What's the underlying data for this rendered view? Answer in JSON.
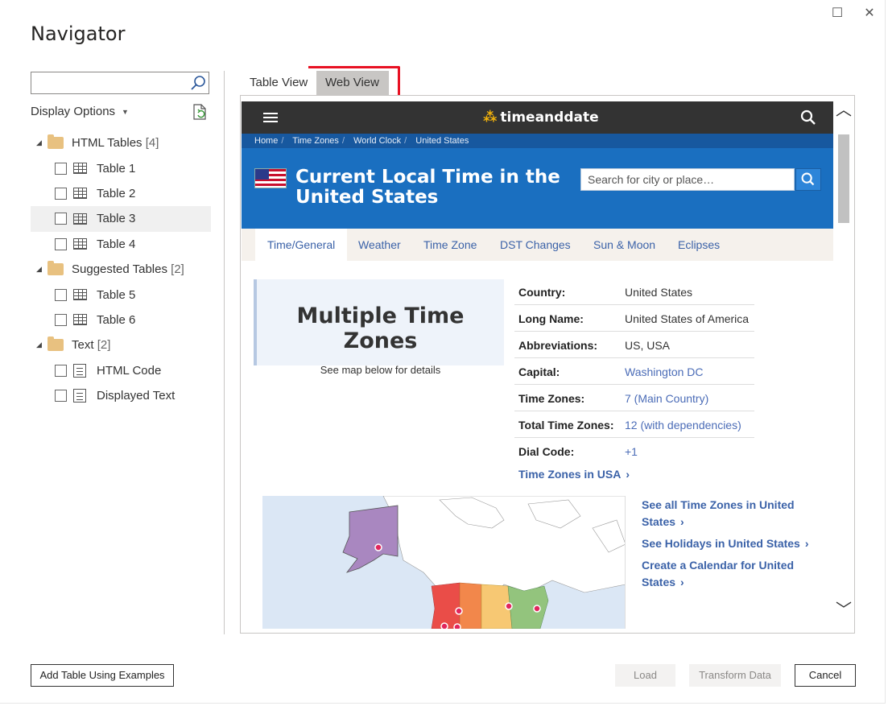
{
  "window": {
    "title": "Navigator",
    "maximize_glyph": "☐",
    "close_glyph": "✕"
  },
  "left_pane": {
    "search": {
      "placeholder": "",
      "value": ""
    },
    "display_options_label": "Display Options",
    "tree": {
      "groups": [
        {
          "label": "HTML Tables",
          "count": "[4]",
          "items": [
            "Table 1",
            "Table 2",
            "Table 3",
            "Table 4"
          ]
        },
        {
          "label": "Suggested Tables",
          "count": "[2]",
          "items": [
            "Table 5",
            "Table 6"
          ]
        },
        {
          "label": "Text",
          "count": "[2]",
          "items": [
            "HTML Code",
            "Displayed Text"
          ]
        }
      ],
      "selected_item": "Table 3"
    }
  },
  "right_pane": {
    "tabs": [
      "Table View",
      "Web View"
    ],
    "active_tab": "Web View",
    "web_page": {
      "logo": "timeanddate",
      "breadcrumbs": [
        "Home",
        "Time Zones",
        "World Clock",
        "United States"
      ],
      "heading": "Current Local Time in the United States",
      "search_placeholder": "Search for city or place…",
      "nav_tabs": [
        "Time/General",
        "Weather",
        "Time Zone",
        "DST Changes",
        "Sun & Moon",
        "Eclipses"
      ],
      "active_nav_tab": "Time/General",
      "tz_box": {
        "title": "Multiple Time Zones",
        "subtitle": "See map below for details"
      },
      "info": [
        {
          "key": "Country:",
          "value": "United States",
          "link": false
        },
        {
          "key": "Long Name:",
          "value": "United States of America",
          "link": false
        },
        {
          "key": "Abbreviations:",
          "value": "US, USA",
          "link": false
        },
        {
          "key": "Capital:",
          "value": "Washington DC",
          "link": true
        },
        {
          "key": "Time Zones:",
          "value": "7 (Main Country)",
          "link": true
        },
        {
          "key": "Total Time Zones:",
          "value": "12 (with dependencies)",
          "link": true
        },
        {
          "key": "Dial Code:",
          "value": "+1",
          "link": true
        }
      ],
      "tz_link": "Time Zones in USA",
      "side_links": [
        "See all Time Zones in United States",
        "See Holidays in United States",
        "Create a Calendar for United States"
      ]
    }
  },
  "footer": {
    "add_table": "Add Table Using Examples",
    "load": "Load",
    "transform": "Transform Data",
    "cancel": "Cancel"
  },
  "colors": {
    "site_header": "#333333",
    "site_blue": "#1a6fc0",
    "link_blue": "#3b62a8",
    "highlight_red": "#e81123"
  }
}
